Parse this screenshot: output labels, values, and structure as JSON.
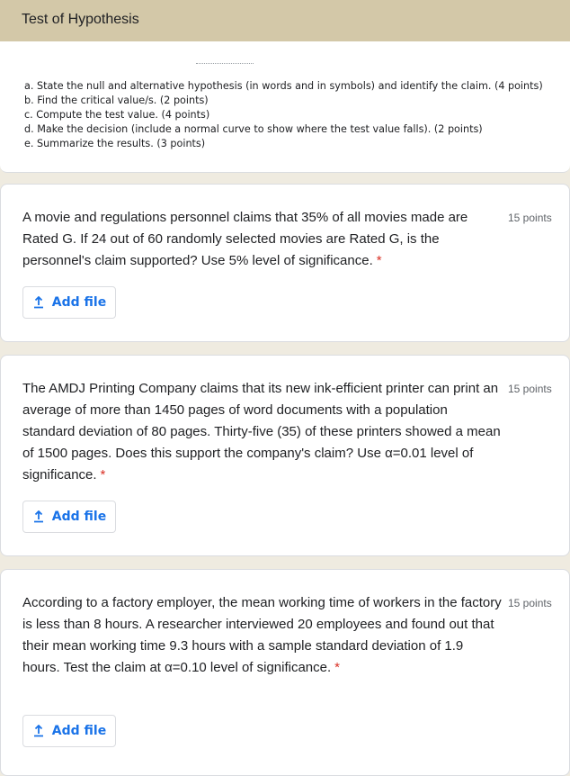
{
  "section": {
    "title": "Test of Hypothesis"
  },
  "instructions": {
    "items": [
      "a. State the null and alternative hypothesis (in words and in symbols) and identify the claim. (4 points)",
      "b. Find the critical value/s. (2 points)",
      "c. Compute the test value. (4 points)",
      "d. Make the decision (include a normal curve to show where the test value falls). (2 points)",
      "e. Summarize the results. (3 points)"
    ]
  },
  "questions": [
    {
      "text": "A movie and regulations personnel claims that 35% of all movies made are Rated G. If 24 out of 60 randomly selected movies are Rated G, is the personnel's claim supported? Use 5% level of significance.",
      "points": "15 points",
      "required_mark": "*",
      "add_file_label": "Add file"
    },
    {
      "text": "The AMDJ Printing Company claims that its new ink-efficient printer can print an average of more than 1450 pages of word documents with a population standard deviation of 80 pages. Thirty-five (35) of these printers showed a mean of 1500 pages. Does this support the company's claim? Use α=0.01 level of significance.",
      "points": "15 points",
      "required_mark": "*",
      "add_file_label": "Add file"
    },
    {
      "text": "According to a factory employer, the mean working time of workers in the factory is less than 8 hours. A researcher interviewed 20 employees and found out that their mean working time 9.3 hours with a sample standard deviation of 1.9 hours. Test the claim at α=0.10 level of significance.",
      "points": "15 points",
      "required_mark": "*",
      "add_file_label": "Add file"
    }
  ],
  "colors": {
    "accent": "#1a73e8",
    "header": "#d3c8a8",
    "required": "#d93025",
    "background": "#efebe0"
  },
  "icons": {
    "upload": "upload-icon"
  }
}
